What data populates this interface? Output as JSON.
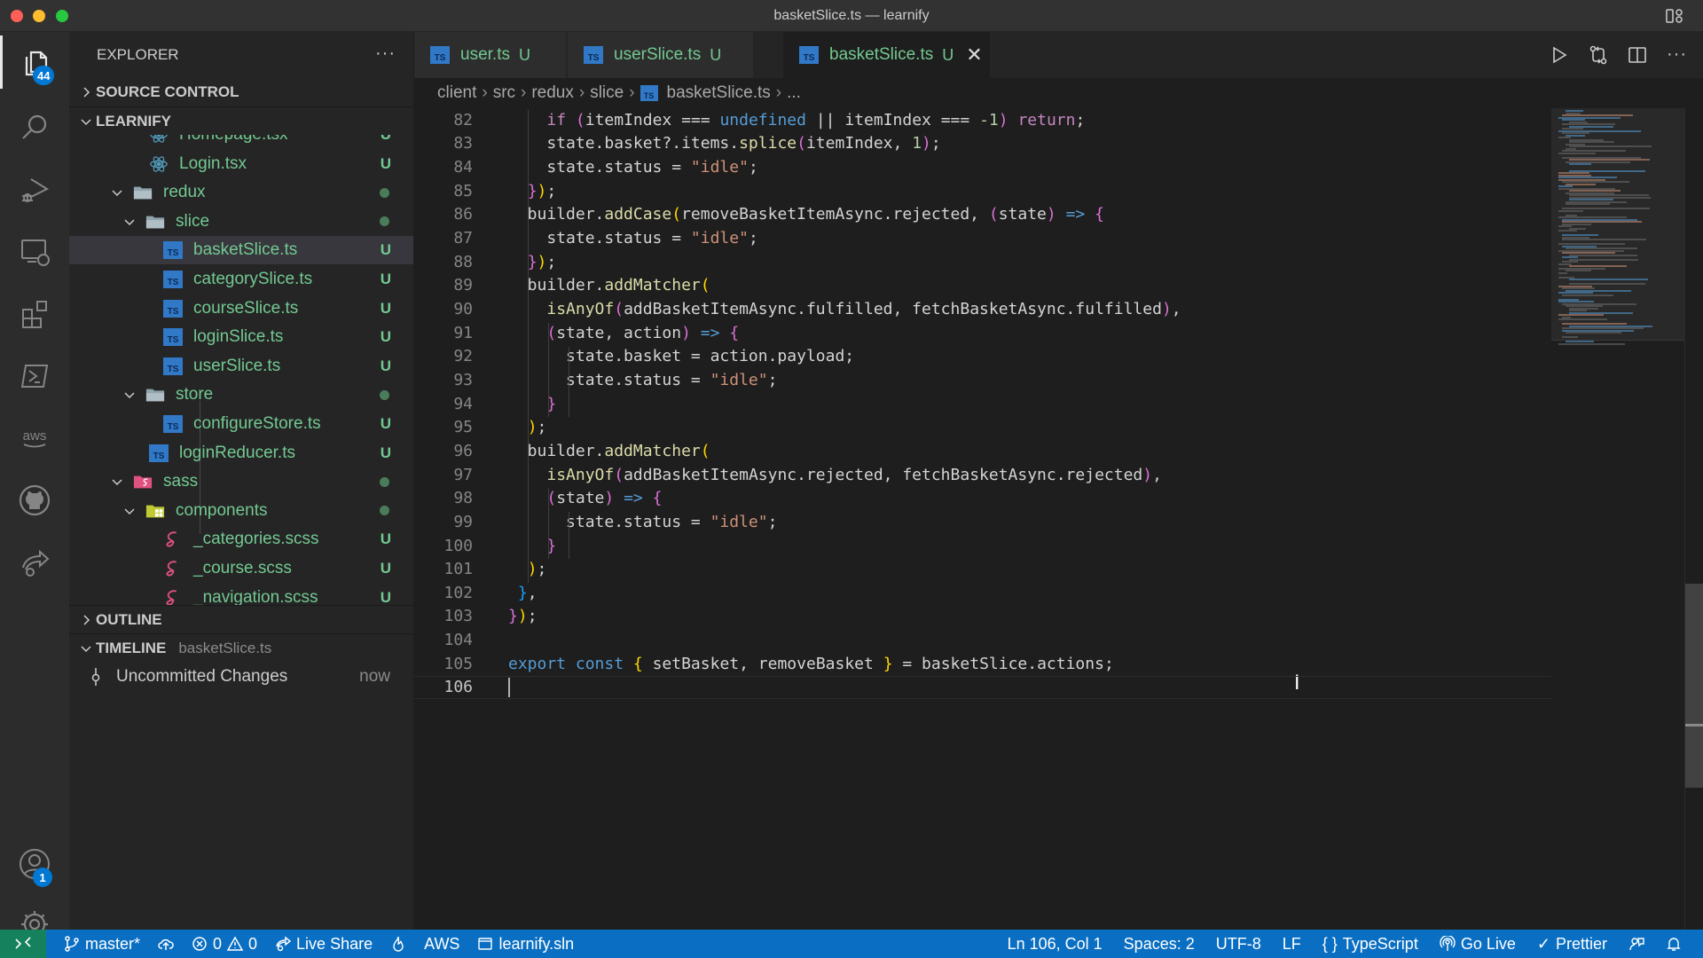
{
  "window": {
    "title": "basketSlice.ts — learnify"
  },
  "activity_bar": {
    "explorer_badge": "44",
    "accounts_badge": "1",
    "items": [
      "explorer",
      "search",
      "run-and-debug",
      "remote-explorer",
      "extensions",
      "powershell",
      "aws",
      "github",
      "live-share"
    ]
  },
  "sidebar": {
    "title": "EXPLORER",
    "more": "···",
    "source_control": "SOURCE CONTROL",
    "project": "LEARNIFY",
    "tree": [
      {
        "name": "Homepage.tsx",
        "type": "react",
        "status": "U",
        "depth": 3
      },
      {
        "name": "Login.tsx",
        "type": "react",
        "status": "U",
        "depth": 3
      },
      {
        "name": "redux",
        "type": "folder",
        "status": "dot",
        "depth": 2
      },
      {
        "name": "slice",
        "type": "folder",
        "status": "dot",
        "depth": 3
      },
      {
        "name": "basketSlice.ts",
        "type": "ts",
        "status": "U",
        "depth": 4,
        "selected": true
      },
      {
        "name": "categorySlice.ts",
        "type": "ts",
        "status": "U",
        "depth": 4
      },
      {
        "name": "courseSlice.ts",
        "type": "ts",
        "status": "U",
        "depth": 4
      },
      {
        "name": "loginSlice.ts",
        "type": "ts",
        "status": "U",
        "depth": 4
      },
      {
        "name": "userSlice.ts",
        "type": "ts",
        "status": "U",
        "depth": 4
      },
      {
        "name": "store",
        "type": "folder",
        "status": "dot",
        "depth": 3
      },
      {
        "name": "configureStore.ts",
        "type": "ts",
        "status": "U",
        "depth": 4
      },
      {
        "name": "loginReducer.ts",
        "type": "ts",
        "status": "U",
        "depth": 3
      },
      {
        "name": "sass",
        "type": "sass-folder",
        "status": "dot",
        "depth": 2
      },
      {
        "name": "components",
        "type": "components-folder",
        "status": "dot",
        "depth": 3
      },
      {
        "name": "_categories.scss",
        "type": "scss",
        "status": "U",
        "depth": 4
      },
      {
        "name": "_course.scss",
        "type": "scss",
        "status": "U",
        "depth": 4
      },
      {
        "name": "_navigation.scss",
        "type": "scss",
        "status": "U",
        "depth": 4
      }
    ],
    "outline": "OUTLINE",
    "timeline": "TIMELINE",
    "timeline_file": "basketSlice.ts",
    "timeline_entry": "Uncommitted Changes",
    "timeline_when": "now"
  },
  "tabs": [
    {
      "label": "user.ts",
      "status": "U",
      "active": false
    },
    {
      "label": "userSlice.ts",
      "status": "U",
      "active": false
    },
    {
      "label": "basketSlice.ts",
      "status": "U",
      "active": true,
      "close": "✕"
    }
  ],
  "breadcrumb": [
    "client",
    "src",
    "redux",
    "slice",
    "basketSlice.ts",
    "..."
  ],
  "editor": {
    "language": "TypeScript",
    "current_line": 106,
    "lines": [
      {
        "n": "82",
        "tokens": [
          [
            "    ",
            ""
          ],
          [
            "if",
            "kw2"
          ],
          [
            " ",
            ""
          ],
          [
            "(",
            "p2"
          ],
          [
            "itemIndex === ",
            ""
          ],
          [
            "undefined",
            "kw"
          ],
          [
            " || itemIndex === ",
            ""
          ],
          [
            "-1",
            "num"
          ],
          [
            ")",
            "p2"
          ],
          [
            " ",
            ""
          ],
          [
            "return",
            "kw2"
          ],
          [
            ";",
            ""
          ]
        ]
      },
      {
        "n": "83",
        "tokens": [
          [
            "    state.basket?.items.",
            ""
          ],
          [
            "splice",
            "fn"
          ],
          [
            "(",
            "p2"
          ],
          [
            "itemIndex, ",
            ""
          ],
          [
            "1",
            "num"
          ],
          [
            ")",
            "p2"
          ],
          [
            ";",
            ""
          ]
        ]
      },
      {
        "n": "84",
        "tokens": [
          [
            "    state.status = ",
            ""
          ],
          [
            "\"idle\"",
            "str"
          ],
          [
            ";",
            ""
          ]
        ]
      },
      {
        "n": "85",
        "tokens": [
          [
            "  ",
            ""
          ],
          [
            "}",
            "p2"
          ],
          [
            ")",
            "p1"
          ],
          [
            ";",
            ""
          ]
        ]
      },
      {
        "n": "86",
        "tokens": [
          [
            "  builder.",
            ""
          ],
          [
            "addCase",
            "fn"
          ],
          [
            "(",
            "p1"
          ],
          [
            "removeBasketItemAsync.rejected, ",
            ""
          ],
          [
            "(",
            "p2"
          ],
          [
            "state",
            ""
          ],
          [
            ")",
            "p2"
          ],
          [
            " ",
            ""
          ],
          [
            "=>",
            "arrow"
          ],
          [
            " ",
            ""
          ],
          [
            "{",
            "p2"
          ]
        ]
      },
      {
        "n": "87",
        "tokens": [
          [
            "    state.status = ",
            ""
          ],
          [
            "\"idle\"",
            "str"
          ],
          [
            ";",
            ""
          ]
        ]
      },
      {
        "n": "88",
        "tokens": [
          [
            "  ",
            ""
          ],
          [
            "}",
            "p2"
          ],
          [
            ")",
            "p1"
          ],
          [
            ";",
            ""
          ]
        ]
      },
      {
        "n": "89",
        "tokens": [
          [
            "  builder.",
            ""
          ],
          [
            "addMatcher",
            "fn"
          ],
          [
            "(",
            "p1"
          ]
        ]
      },
      {
        "n": "90",
        "tokens": [
          [
            "    ",
            ""
          ],
          [
            "isAnyOf",
            "fn"
          ],
          [
            "(",
            "p2"
          ],
          [
            "addBasketItemAsync.fulfilled, fetchBasketAsync.fulfilled",
            ""
          ],
          [
            ")",
            "p2"
          ],
          [
            ",",
            ""
          ]
        ]
      },
      {
        "n": "91",
        "tokens": [
          [
            "    ",
            ""
          ],
          [
            "(",
            "p2"
          ],
          [
            "state, action",
            ""
          ],
          [
            ")",
            "p2"
          ],
          [
            " ",
            ""
          ],
          [
            "=>",
            "arrow"
          ],
          [
            " ",
            ""
          ],
          [
            "{",
            "p2"
          ]
        ]
      },
      {
        "n": "92",
        "tokens": [
          [
            "      state.basket = action.payload;",
            ""
          ]
        ]
      },
      {
        "n": "93",
        "tokens": [
          [
            "      state.status = ",
            ""
          ],
          [
            "\"idle\"",
            "str"
          ],
          [
            ";",
            ""
          ]
        ]
      },
      {
        "n": "94",
        "tokens": [
          [
            "    ",
            ""
          ],
          [
            "}",
            "p2"
          ]
        ]
      },
      {
        "n": "95",
        "tokens": [
          [
            "  ",
            ""
          ],
          [
            ")",
            "p1"
          ],
          [
            ";",
            ""
          ]
        ]
      },
      {
        "n": "96",
        "tokens": [
          [
            "  builder.",
            ""
          ],
          [
            "addMatcher",
            "fn"
          ],
          [
            "(",
            "p1"
          ]
        ]
      },
      {
        "n": "97",
        "tokens": [
          [
            "    ",
            ""
          ],
          [
            "isAnyOf",
            "fn"
          ],
          [
            "(",
            "p2"
          ],
          [
            "addBasketItemAsync.rejected, fetchBasketAsync.rejected",
            ""
          ],
          [
            ")",
            "p2"
          ],
          [
            ",",
            ""
          ]
        ]
      },
      {
        "n": "98",
        "tokens": [
          [
            "    ",
            ""
          ],
          [
            "(",
            "p2"
          ],
          [
            "state",
            ""
          ],
          [
            ")",
            "p2"
          ],
          [
            " ",
            ""
          ],
          [
            "=>",
            "arrow"
          ],
          [
            " ",
            ""
          ],
          [
            "{",
            "p2"
          ]
        ]
      },
      {
        "n": "99",
        "tokens": [
          [
            "      state.status = ",
            ""
          ],
          [
            "\"idle\"",
            "str"
          ],
          [
            ";",
            ""
          ]
        ]
      },
      {
        "n": "100",
        "tokens": [
          [
            "    ",
            ""
          ],
          [
            "}",
            "p2"
          ]
        ]
      },
      {
        "n": "101",
        "tokens": [
          [
            "  ",
            ""
          ],
          [
            ")",
            "p1"
          ],
          [
            ";",
            ""
          ]
        ]
      },
      {
        "n": "102",
        "tokens": [
          [
            " ",
            ""
          ],
          [
            "}",
            "p3"
          ],
          [
            ",",
            ""
          ]
        ]
      },
      {
        "n": "103",
        "tokens": [
          [
            "}",
            "p2"
          ],
          [
            ")",
            "p1"
          ],
          [
            ";",
            ""
          ]
        ]
      },
      {
        "n": "104",
        "tokens": []
      },
      {
        "n": "105",
        "tokens": [
          [
            "export",
            "kw"
          ],
          [
            " ",
            ""
          ],
          [
            "const",
            "kw"
          ],
          [
            " ",
            ""
          ],
          [
            "{",
            "p1"
          ],
          [
            " setBasket, removeBasket ",
            ""
          ],
          [
            "}",
            "p1"
          ],
          [
            " = basketSlice.actions;",
            ""
          ]
        ]
      },
      {
        "n": "106",
        "tokens": []
      }
    ]
  },
  "statusbar": {
    "remote": "><",
    "branch": "master*",
    "errors": "0",
    "warnings": "0",
    "live_share": "Live Share",
    "aws": "AWS",
    "solution": "learnify.sln",
    "cursor": "Ln 106, Col 1",
    "spaces": "Spaces: 2",
    "encoding": "UTF-8",
    "eol": "LF",
    "language": "TypeScript",
    "go_live": "Go Live",
    "prettier": "Prettier"
  },
  "colors": {
    "accent": "#0a6fc2",
    "remote": "#16825d",
    "untracked": "#73c991",
    "badge": "#0078d4"
  }
}
